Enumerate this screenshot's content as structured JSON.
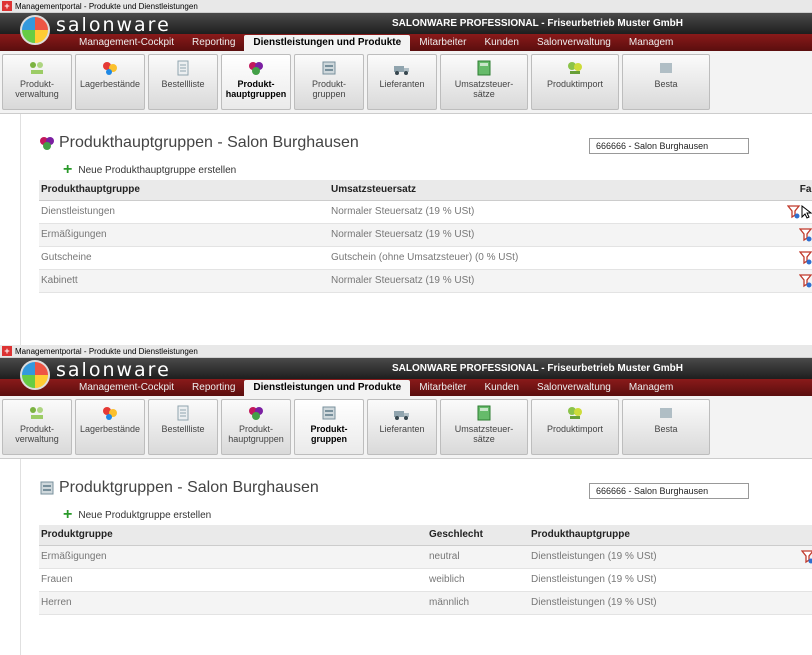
{
  "panel1": {
    "window_title": "Managementportal - Produkte und Dienstleistungen",
    "logo": "salonware",
    "brand": "SALONWARE PROFESSIONAL - Friseurbetrieb Muster GmbH",
    "tabs": [
      {
        "label": "Management-Cockpit",
        "active": false
      },
      {
        "label": "Reporting",
        "active": false
      },
      {
        "label": "Dienstleistungen und Produkte",
        "active": true
      },
      {
        "label": "Mitarbeiter",
        "active": false
      },
      {
        "label": "Kunden",
        "active": false
      },
      {
        "label": "Salonverwaltung",
        "active": false
      },
      {
        "label": "Managem",
        "active": false
      }
    ],
    "tools": [
      {
        "line1": "Produkt-",
        "line2": "verwaltung",
        "active": false
      },
      {
        "line1": "Lagerbestände",
        "line2": "",
        "active": false
      },
      {
        "line1": "Bestellliste",
        "line2": "",
        "active": false
      },
      {
        "line1": "Produkt-",
        "line2": "hauptgruppen",
        "active": true
      },
      {
        "line1": "Produkt-",
        "line2": "gruppen",
        "active": false
      },
      {
        "line1": "Lieferanten",
        "line2": "",
        "active": false
      },
      {
        "line1": "Umsatzsteuer-",
        "line2": "sätze",
        "active": false
      },
      {
        "line1": "Produktimport",
        "line2": "",
        "active": false
      },
      {
        "line1": "Besta",
        "line2": "",
        "active": false
      }
    ],
    "page_title": "Produkthauptgruppen - Salon Burghausen",
    "salon_select": "666666 - Salon Burghausen",
    "create_label": "Neue Produkthauptgruppe erstellen",
    "columns": [
      "Produkthauptgruppe",
      "Umsatzsteuersatz",
      "Farbe"
    ],
    "rows": [
      {
        "name": "Dienstleistungen",
        "tax": "Normaler Steuersatz (19 % USt)",
        "color": "#000000"
      },
      {
        "name": "Ermäßigungen",
        "tax": "Normaler Steuersatz (19 % USt)",
        "color": "#888888"
      },
      {
        "name": "Gutscheine",
        "tax": "Gutschein (ohne Umsatzsteuer) (0 % USt)",
        "color": "#22dd22"
      },
      {
        "name": "Kabinett",
        "tax": "Normaler Steuersatz (19 % USt)",
        "color": "#888888"
      }
    ]
  },
  "panel2": {
    "window_title": "Managementportal - Produkte und Dienstleistungen",
    "logo": "salonware",
    "brand": "SALONWARE PROFESSIONAL - Friseurbetrieb Muster GmbH",
    "tabs": [
      {
        "label": "Management-Cockpit",
        "active": false
      },
      {
        "label": "Reporting",
        "active": false
      },
      {
        "label": "Dienstleistungen und Produkte",
        "active": true
      },
      {
        "label": "Mitarbeiter",
        "active": false
      },
      {
        "label": "Kunden",
        "active": false
      },
      {
        "label": "Salonverwaltung",
        "active": false
      },
      {
        "label": "Managem",
        "active": false
      }
    ],
    "tools": [
      {
        "line1": "Produkt-",
        "line2": "verwaltung",
        "active": false
      },
      {
        "line1": "Lagerbestände",
        "line2": "",
        "active": false
      },
      {
        "line1": "Bestellliste",
        "line2": "",
        "active": false
      },
      {
        "line1": "Produkt-",
        "line2": "hauptgruppen",
        "active": false
      },
      {
        "line1": "Produkt-",
        "line2": "gruppen",
        "active": true
      },
      {
        "line1": "Lieferanten",
        "line2": "",
        "active": false
      },
      {
        "line1": "Umsatzsteuer-",
        "line2": "sätze",
        "active": false
      },
      {
        "line1": "Produktimport",
        "line2": "",
        "active": false
      },
      {
        "line1": "Besta",
        "line2": "",
        "active": false
      }
    ],
    "page_title": "Produktgruppen - Salon Burghausen",
    "salon_select": "666666 - Salon Burghausen",
    "create_label": "Neue Produktgruppe erstellen",
    "columns": [
      "Produktgruppe",
      "Geschlecht",
      "Produkthauptgruppe"
    ],
    "rows": [
      {
        "name": "Ermäßigungen",
        "gender": "neutral",
        "main_group": "Dienstleistungen (19 % USt)"
      },
      {
        "name": "Frauen",
        "gender": "weiblich",
        "main_group": "Dienstleistungen (19 % USt)"
      },
      {
        "name": "Herren",
        "gender": "männlich",
        "main_group": "Dienstleistungen (19 % USt)"
      }
    ]
  }
}
